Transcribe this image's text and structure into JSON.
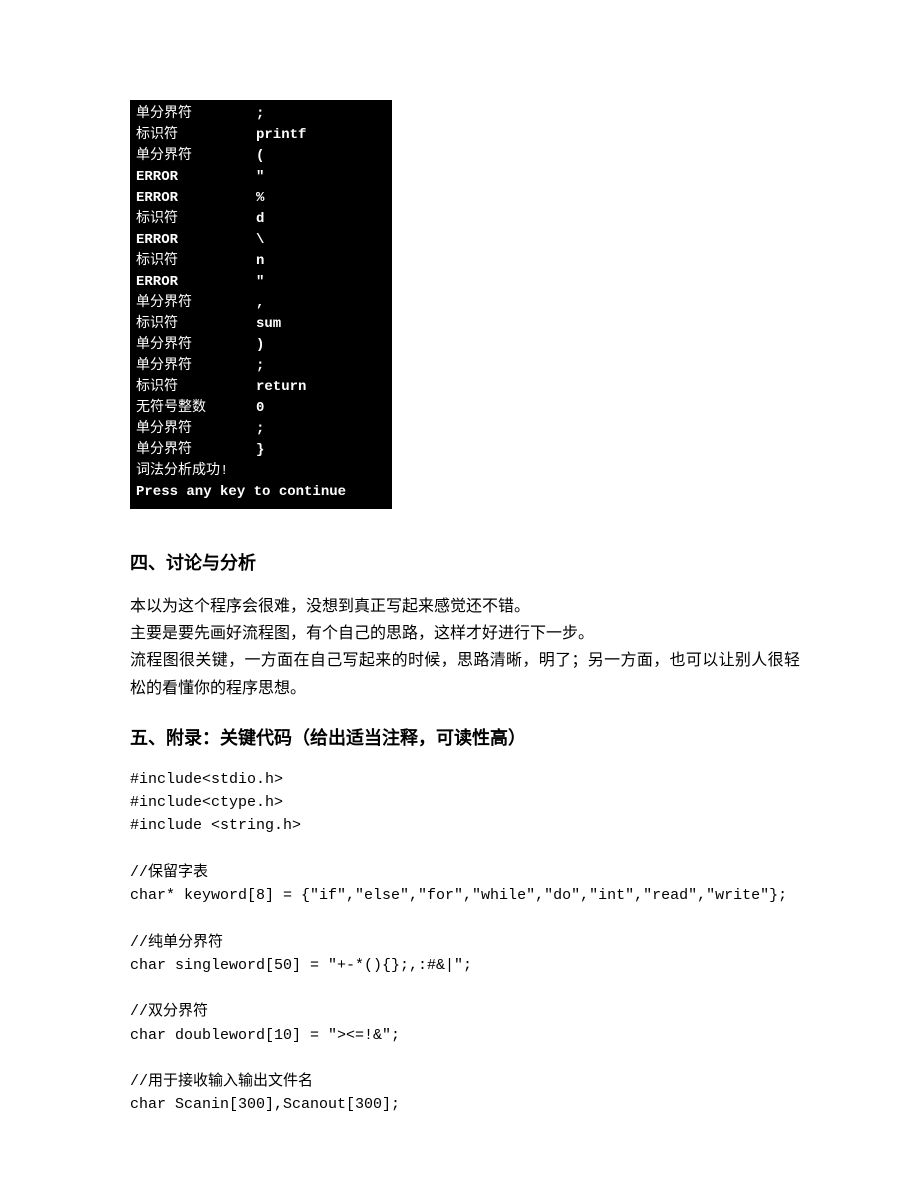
{
  "terminal": {
    "rows": [
      {
        "label": "单分界符",
        "value": ";",
        "labelBold": false,
        "valueBold": true
      },
      {
        "label": "标识符",
        "value": "printf",
        "labelBold": false,
        "valueBold": true
      },
      {
        "label": "单分界符",
        "value": "(",
        "labelBold": false,
        "valueBold": true
      },
      {
        "label": "ERROR",
        "value": "\"",
        "labelBold": true,
        "valueBold": true
      },
      {
        "label": "ERROR",
        "value": "%",
        "labelBold": true,
        "valueBold": true
      },
      {
        "label": "标识符",
        "value": "d",
        "labelBold": false,
        "valueBold": true
      },
      {
        "label": "ERROR",
        "value": "\\",
        "labelBold": true,
        "valueBold": true
      },
      {
        "label": "标识符",
        "value": "n",
        "labelBold": false,
        "valueBold": true
      },
      {
        "label": "ERROR",
        "value": "\"",
        "labelBold": true,
        "valueBold": true
      },
      {
        "label": "单分界符",
        "value": ",",
        "labelBold": false,
        "valueBold": true
      },
      {
        "label": "标识符",
        "value": "sum",
        "labelBold": false,
        "valueBold": true
      },
      {
        "label": "单分界符",
        "value": ")",
        "labelBold": false,
        "valueBold": true
      },
      {
        "label": "单分界符",
        "value": ";",
        "labelBold": false,
        "valueBold": true
      },
      {
        "label": "标识符",
        "value": "return",
        "labelBold": false,
        "valueBold": true
      },
      {
        "label": "无符号整数",
        "value": "0",
        "labelBold": false,
        "valueBold": true
      },
      {
        "label": "单分界符",
        "value": ";",
        "labelBold": false,
        "valueBold": true
      },
      {
        "label": "单分界符",
        "value": "}",
        "labelBold": false,
        "valueBold": true
      }
    ],
    "success": "词法分析成功!",
    "prompt": "Press any key to continue"
  },
  "section4": {
    "heading": "四、讨论与分析",
    "p1": "本以为这个程序会很难，没想到真正写起来感觉还不错。",
    "p2": "主要是要先画好流程图，有个自己的思路，这样才好进行下一步。",
    "p3": "流程图很关键，一方面在自己写起来的时候，思路清晰，明了；另一方面，也可以让别人很轻松的看懂你的程序思想。"
  },
  "section5": {
    "heading": "五、附录：关键代码（给出适当注释，可读性高）",
    "code_lines": [
      "#include<stdio.h>",
      "#include<ctype.h>",
      "#include <string.h>",
      "",
      "//保留字表",
      "char* keyword[8] = {\"if\",\"else\",\"for\",\"while\",\"do\",\"int\",\"read\",\"write\"};",
      "",
      "//纯单分界符",
      "char singleword[50] = \"+-*(){};,:#&|\";",
      "",
      "//双分界符",
      "char doubleword[10] = \"><=!&\";",
      "",
      "//用于接收输入输出文件名",
      "char Scanin[300],Scanout[300];"
    ]
  }
}
